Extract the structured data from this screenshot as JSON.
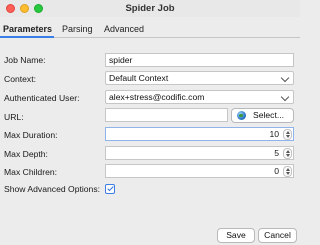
{
  "window": {
    "title": "Spider Job"
  },
  "tabs": [
    {
      "label": "Parameters",
      "active": true
    },
    {
      "label": "Parsing",
      "active": false
    },
    {
      "label": "Advanced",
      "active": false
    }
  ],
  "form": {
    "job_name": {
      "label": "Job Name:",
      "value": "spider"
    },
    "context": {
      "label": "Context:",
      "value": "Default Context"
    },
    "authenticated_user": {
      "label": "Authenticated User:",
      "value": "alex+stress@codific.com"
    },
    "url": {
      "label": "URL:",
      "value": "",
      "select_label": "Select..."
    },
    "max_duration": {
      "label": "Max Duration:",
      "value": "10"
    },
    "max_depth": {
      "label": "Max Depth:",
      "value": "5"
    },
    "max_children": {
      "label": "Max Children:",
      "value": "0"
    },
    "show_advanced": {
      "label": "Show Advanced Options:",
      "checked": true
    }
  },
  "footer": {
    "save_label": "Save",
    "cancel_label": "Cancel"
  },
  "colors": {
    "accent": "#3a7ee8",
    "close": "#fe5f57",
    "minimize": "#febc2e",
    "maximize": "#28c840"
  }
}
